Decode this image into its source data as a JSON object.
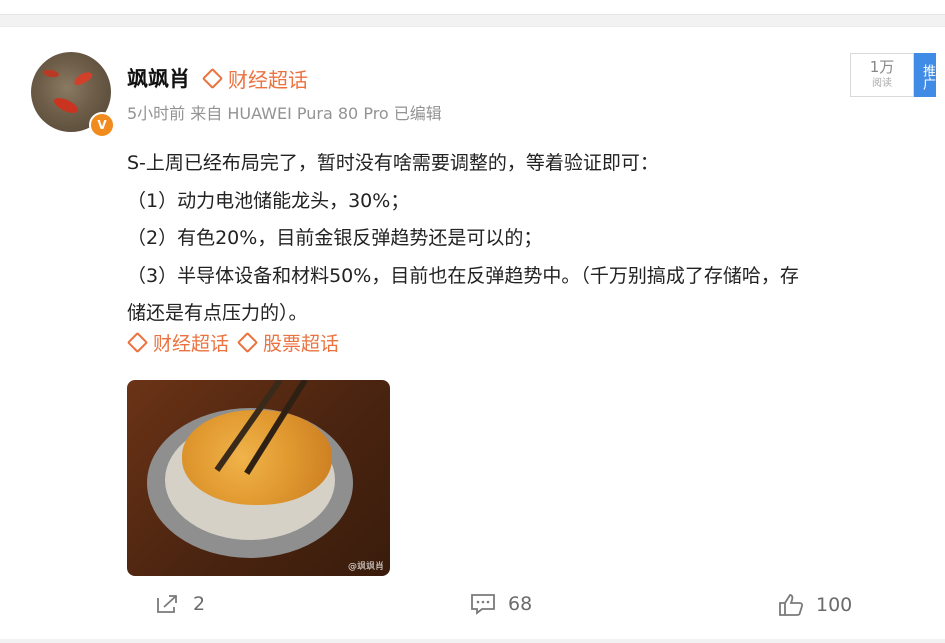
{
  "user": {
    "name": "飒飒肖",
    "badge_topic": "财经超话",
    "meta": "5小时前  来自 HUAWEI Pura 80 Pro 已编辑",
    "verified_mark": "V"
  },
  "promo": {
    "views_count": "1万",
    "views_label": "阅读",
    "tag": "推广"
  },
  "post": {
    "lines": [
      "S-上周已经布局完了，暂时没有啥需要调整的，等着验证即可：",
      "（1）动力电池储能龙头，30%；",
      "（2）有色20%，目前金银反弹趋势还是可以的；",
      "（3）半导体设备和材料50%，目前也在反弹趋势中。（千万别搞成了存储哈，存",
      "储还是有点压力的）。"
    ],
    "topics": [
      "财经超话",
      "股票超话"
    ],
    "image_watermark": "@飒飒肖"
  },
  "actions": {
    "share_count": "2",
    "comment_count": "68",
    "like_count": "100"
  },
  "colors": {
    "accent": "#eb7340",
    "promo_blue": "#3f8be6",
    "verified": "#f28b1d"
  },
  "icons": {
    "share": "share-icon",
    "comment": "comment-icon",
    "like": "thumbs-up-icon",
    "topic": "diamond-icon"
  }
}
